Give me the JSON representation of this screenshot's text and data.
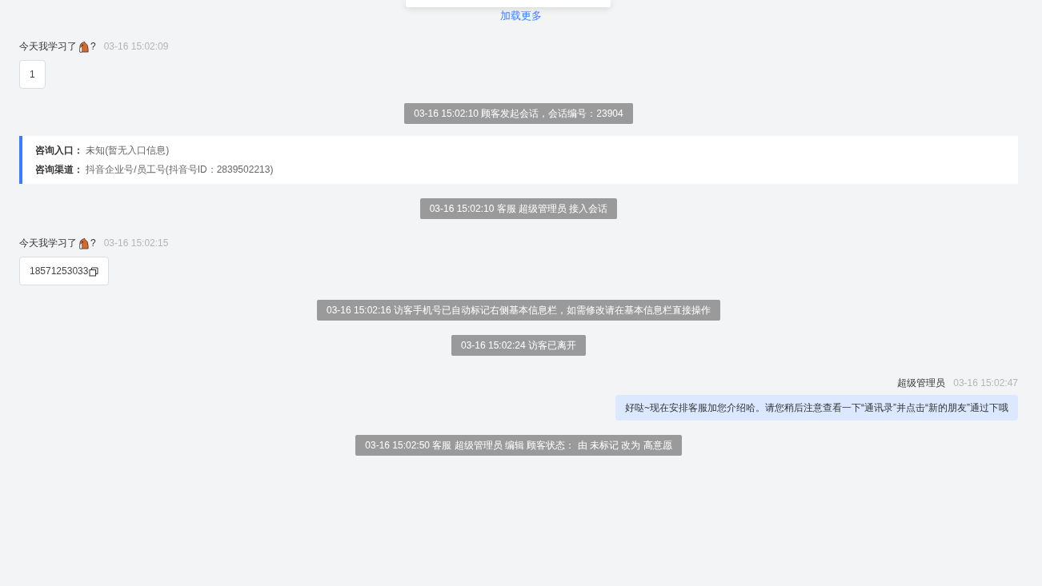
{
  "load_more": "加载更多",
  "messages": [
    {
      "kind": "visitor",
      "name": "今天我学习了",
      "name_suffix": "?",
      "time": "03-16 15:02:09",
      "text": "1",
      "copyable": false
    },
    {
      "kind": "system",
      "text": "03-16 15:02:10 顾客发起会话，会话编号：23904"
    },
    {
      "kind": "info",
      "rows": [
        {
          "label": "咨询入口：",
          "value": "未知(暂无入口信息)"
        },
        {
          "label": "咨询渠道：",
          "value": "抖音企业号/员工号(抖音号ID：2839502213)"
        }
      ]
    },
    {
      "kind": "system",
      "text": "03-16 15:02:10 客服 超级管理员 接入会话"
    },
    {
      "kind": "visitor",
      "name": "今天我学习了",
      "name_suffix": "?",
      "time": "03-16 15:02:15",
      "text": "18571253033",
      "copyable": true
    },
    {
      "kind": "system",
      "text": "03-16 15:02:16 访客手机号已自动标记右侧基本信息栏，如需修改请在基本信息栏直接操作"
    },
    {
      "kind": "system",
      "text": "03-16 15:02:24 访客已离开"
    },
    {
      "kind": "agent",
      "name": "超级管理员",
      "time": "03-16 15:02:47",
      "text": "好哒~现在安排客服加您介绍哈。请您稍后注意查看一下“通讯录”并点击“新的朋友”通过下哦"
    },
    {
      "kind": "system",
      "text": "03-16 15:02:50 客服 超级管理员 编辑 顾客状态： 由 未标记 改为 高意愿"
    }
  ]
}
